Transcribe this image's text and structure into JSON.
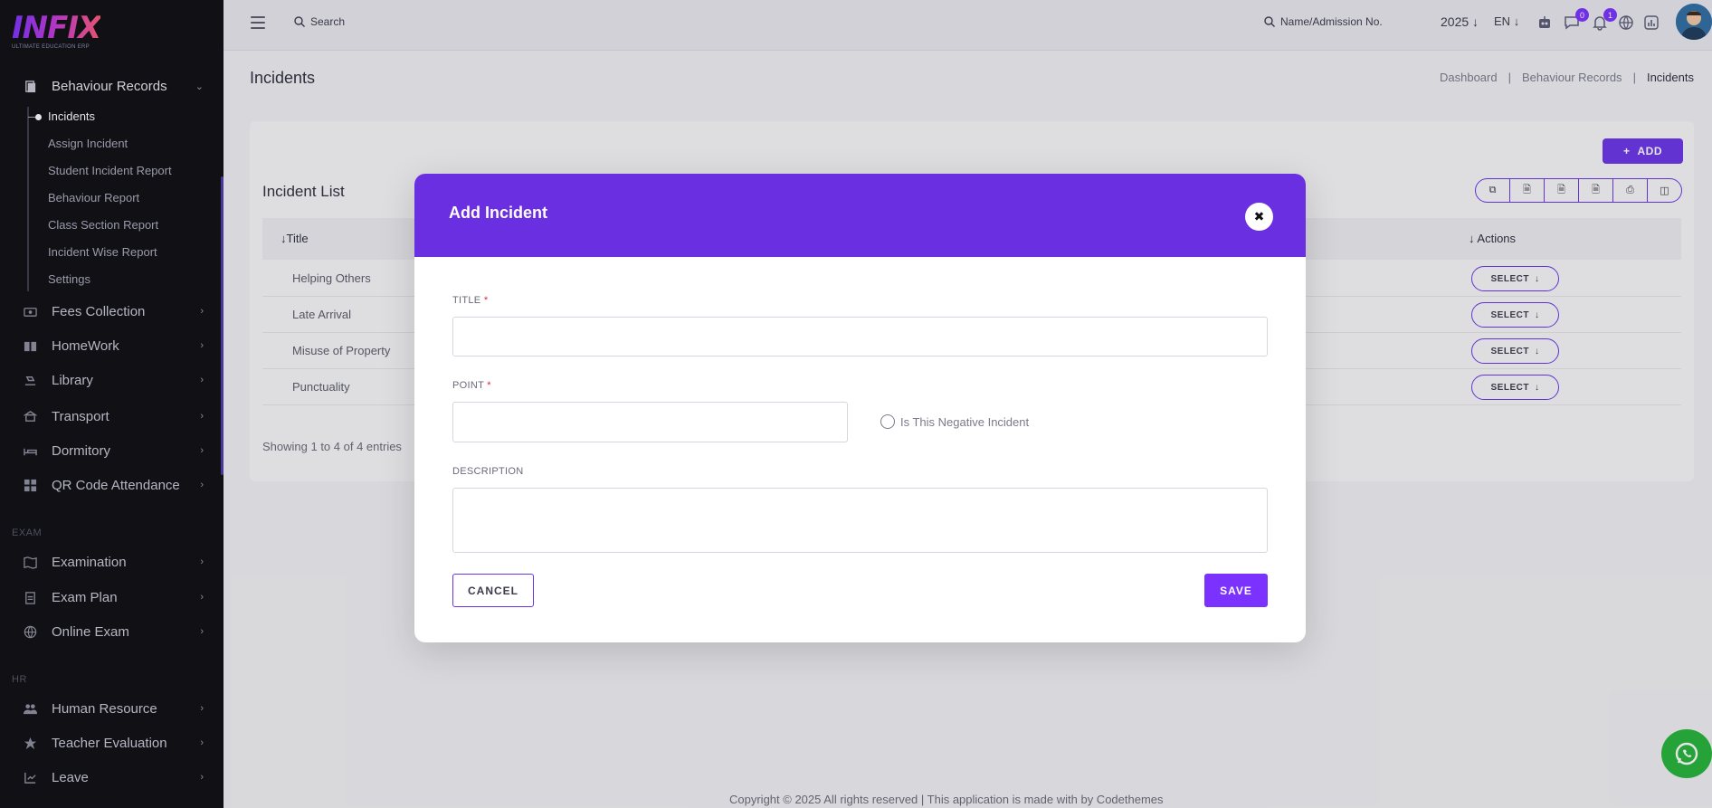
{
  "brand": {
    "logo_text": "INFIX",
    "logo_sub": "ULTIMATE EDUCATION ERP"
  },
  "sidebar": {
    "open_menu": {
      "label": "Behaviour Records",
      "icon": "document-icon"
    },
    "sub_items": [
      {
        "label": "Incidents"
      },
      {
        "label": "Assign Incident"
      },
      {
        "label": "Student Incident Report"
      },
      {
        "label": "Behaviour Report"
      },
      {
        "label": "Class Section Report"
      },
      {
        "label": "Incident Wise Report"
      },
      {
        "label": "Settings"
      }
    ],
    "items_a": [
      {
        "label": "Fees Collection",
        "icon": "money-icon"
      },
      {
        "label": "HomeWork",
        "icon": "book-icon"
      },
      {
        "label": "Library",
        "icon": "library-icon"
      },
      {
        "label": "Transport",
        "icon": "bus-icon"
      },
      {
        "label": "Dormitory",
        "icon": "bed-icon"
      },
      {
        "label": "QR Code Attendance",
        "icon": "qr-icon"
      }
    ],
    "section_exam": "EXAM",
    "items_exam": [
      {
        "label": "Examination",
        "icon": "map-icon"
      },
      {
        "label": "Exam Plan",
        "icon": "clipboard-icon"
      },
      {
        "label": "Online Exam",
        "icon": "globe-icon"
      }
    ],
    "section_hr": "HR",
    "items_hr": [
      {
        "label": "Human Resource",
        "icon": "users-icon"
      },
      {
        "label": "Teacher Evaluation",
        "icon": "star-icon"
      },
      {
        "label": "Leave",
        "icon": "leave-icon"
      }
    ]
  },
  "topbar": {
    "search_label": "Search",
    "admission_search": "Name/Admission No.",
    "year": "2025",
    "language": "EN",
    "chat_badge": "0",
    "notification_badge": "1"
  },
  "page": {
    "title": "Incidents",
    "breadcrumb": [
      "Dashboard",
      "|",
      "Behaviour Records",
      "|",
      "Incidents"
    ]
  },
  "incident_list": {
    "add_label": "ADD",
    "title": "Incident List",
    "col_title": "Title",
    "col_actions": "Actions",
    "rows": [
      {
        "title": "Helping Others",
        "action": "SELECT"
      },
      {
        "title": "Late Arrival",
        "action": "SELECT"
      },
      {
        "title": "Misuse of Property",
        "action": "SELECT"
      },
      {
        "title": "Punctuality",
        "action": "SELECT"
      }
    ],
    "showing": "Showing 1 to 4 of 4 entries"
  },
  "footer": "Copyright © 2025 All rights reserved | This application is made with by Codethemes",
  "modal": {
    "title": "Add Incident",
    "title_label": "TITLE",
    "point_label": "POINT",
    "required_mark": "*",
    "negative_label": "Is This Negative Incident",
    "description_label": "DESCRIPTION",
    "title_value": "",
    "point_value": "",
    "description_value": "",
    "cancel_label": "CANCEL",
    "save_label": "SAVE"
  },
  "colors": {
    "accent": "#7c32ff",
    "modal_header": "#6a2fe0",
    "sidebar_bg": "#0d0d12"
  }
}
